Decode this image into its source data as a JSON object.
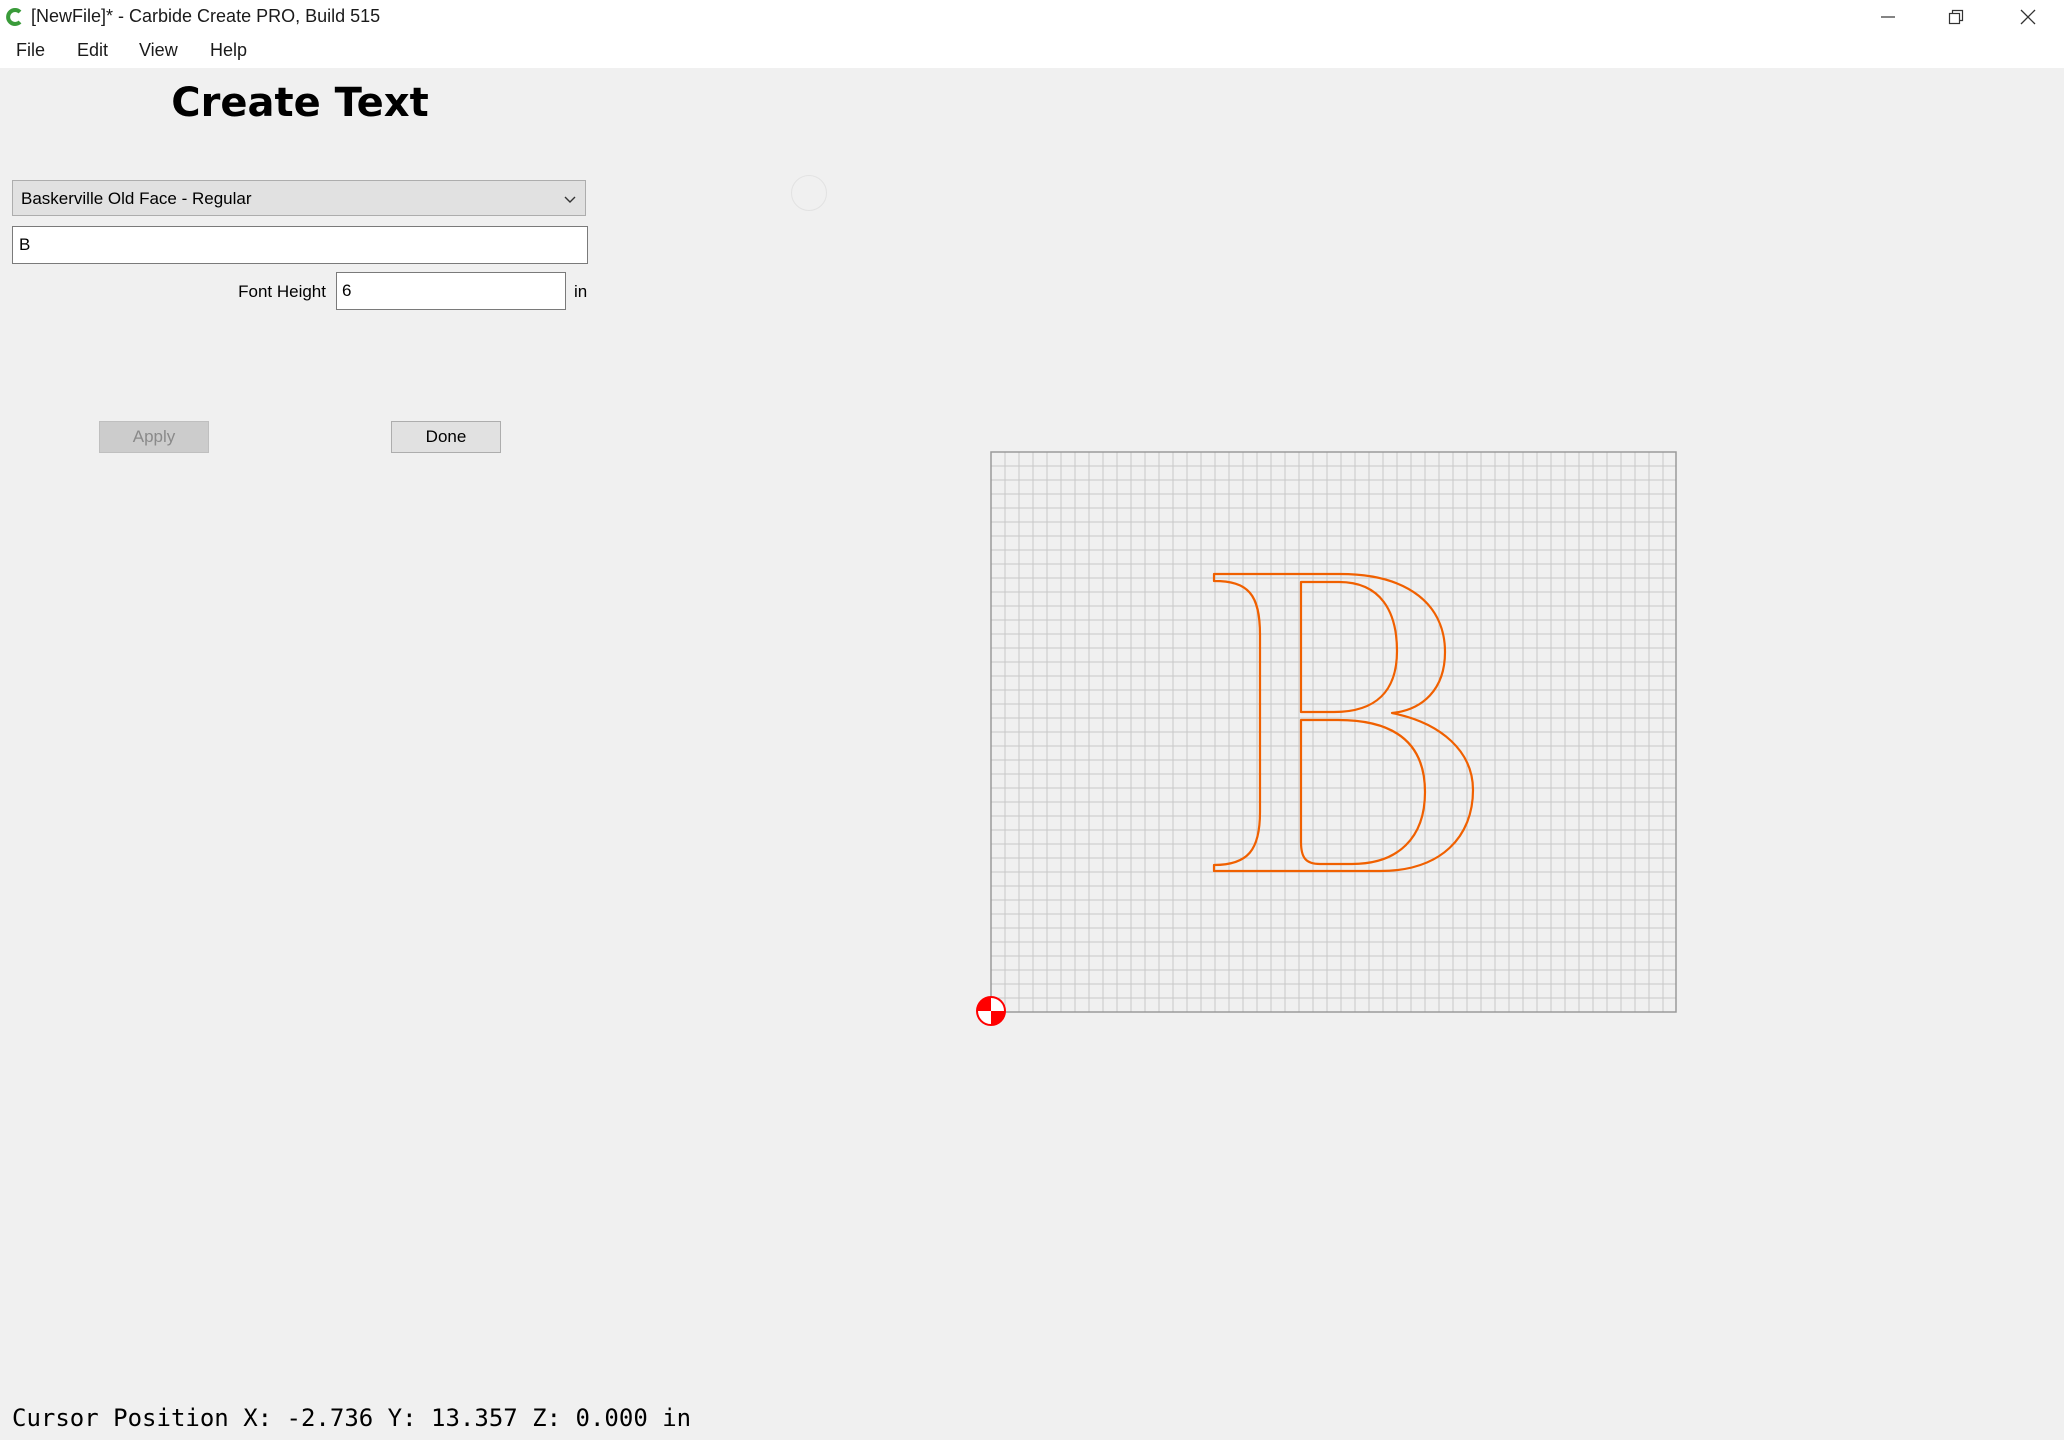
{
  "window": {
    "title": "[NewFile]* - Carbide Create PRO, Build 515",
    "controls": [
      "minimize-icon",
      "restore-icon",
      "close-icon"
    ]
  },
  "menu": {
    "items": [
      "File",
      "Edit",
      "View",
      "Help"
    ]
  },
  "panel": {
    "title": "Create Text",
    "font_select": "Baskerville Old Face - Regular",
    "text_value": "B",
    "font_height_label": "Font Height",
    "font_height_value": "6",
    "font_height_unit": "in",
    "apply_label": "Apply",
    "done_label": "Done"
  },
  "canvas": {
    "glyph": "B",
    "outline_color": "#f06000",
    "grid_color": "#c8c8c8",
    "origin_marker_color": "#ff0000"
  },
  "status": {
    "cursor_position": "Cursor Position X: -2.736 Y: 13.357 Z: 0.000 in"
  }
}
